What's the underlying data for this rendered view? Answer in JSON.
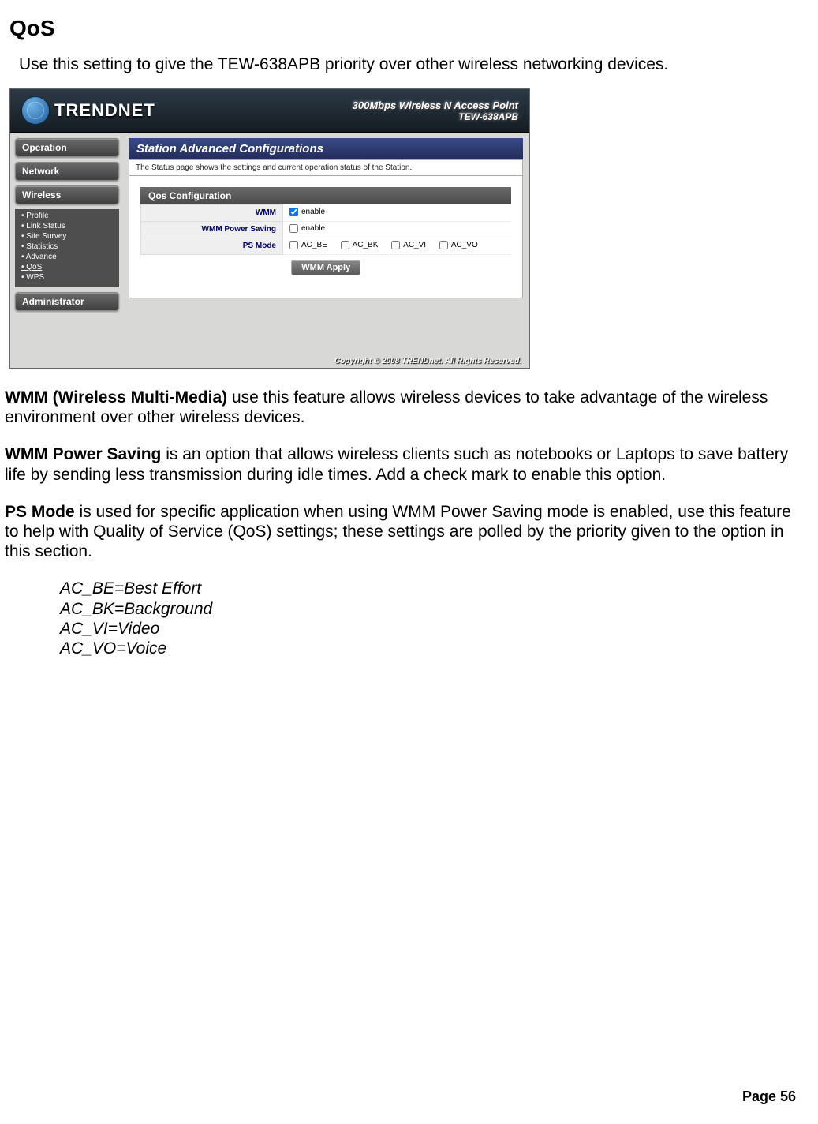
{
  "page": {
    "title": "QoS",
    "intro": "Use this setting to give the TEW-638APB priority over other wireless networking devices."
  },
  "screenshot": {
    "brand": "TRENDNET",
    "product_line1": "300Mbps Wireless N Access Point",
    "product_line2": "TEW-638APB",
    "nav": {
      "operation": "Operation",
      "network": "Network",
      "wireless": "Wireless",
      "administrator": "Administrator"
    },
    "submenu": {
      "profile": "Profile",
      "link_status": "Link Status",
      "site_survey": "Site Survey",
      "statistics": "Statistics",
      "advance": "Advance",
      "qos": "QoS",
      "wps": "WPS"
    },
    "main_title": "Station Advanced Configurations",
    "main_desc": "The Status page shows the settings and current operation status of the Station.",
    "panel_head": "Qos Configuration",
    "labels": {
      "wmm": "WMM",
      "wmm_ps": "WMM Power Saving",
      "ps_mode": "PS Mode"
    },
    "enable_text": "enable",
    "ps_options": {
      "be": "AC_BE",
      "bk": "AC_BK",
      "vi": "AC_VI",
      "vo": "AC_VO"
    },
    "apply": "WMM Apply",
    "copyright": "Copyright © 2008 TRENDnet. All Rights Reserved."
  },
  "body_text": {
    "wmm_bold": "WMM (Wireless Multi-Media)",
    "wmm_rest": " use this feature allows wireless devices to take advantage of the wireless environment over other wireless devices.",
    "ps_bold": "WMM Power Saving",
    "ps_rest": " is an option that allows wireless clients such as notebooks or Laptops to save battery life by sending less transmission during idle times. Add a check mark to enable this option.",
    "mode_bold": "PS Mode",
    "mode_rest": " is used for specific application when using WMM Power Saving mode is enabled, use this feature to help with Quality of Service (QoS) settings; these settings are polled by the priority given to the option in this section.",
    "ac_be": "AC_BE=Best Effort",
    "ac_bk": "AC_BK=Background",
    "ac_vi": "AC_VI=Video",
    "ac_vo": "AC_VO=Voice"
  },
  "page_number": "Page 56"
}
